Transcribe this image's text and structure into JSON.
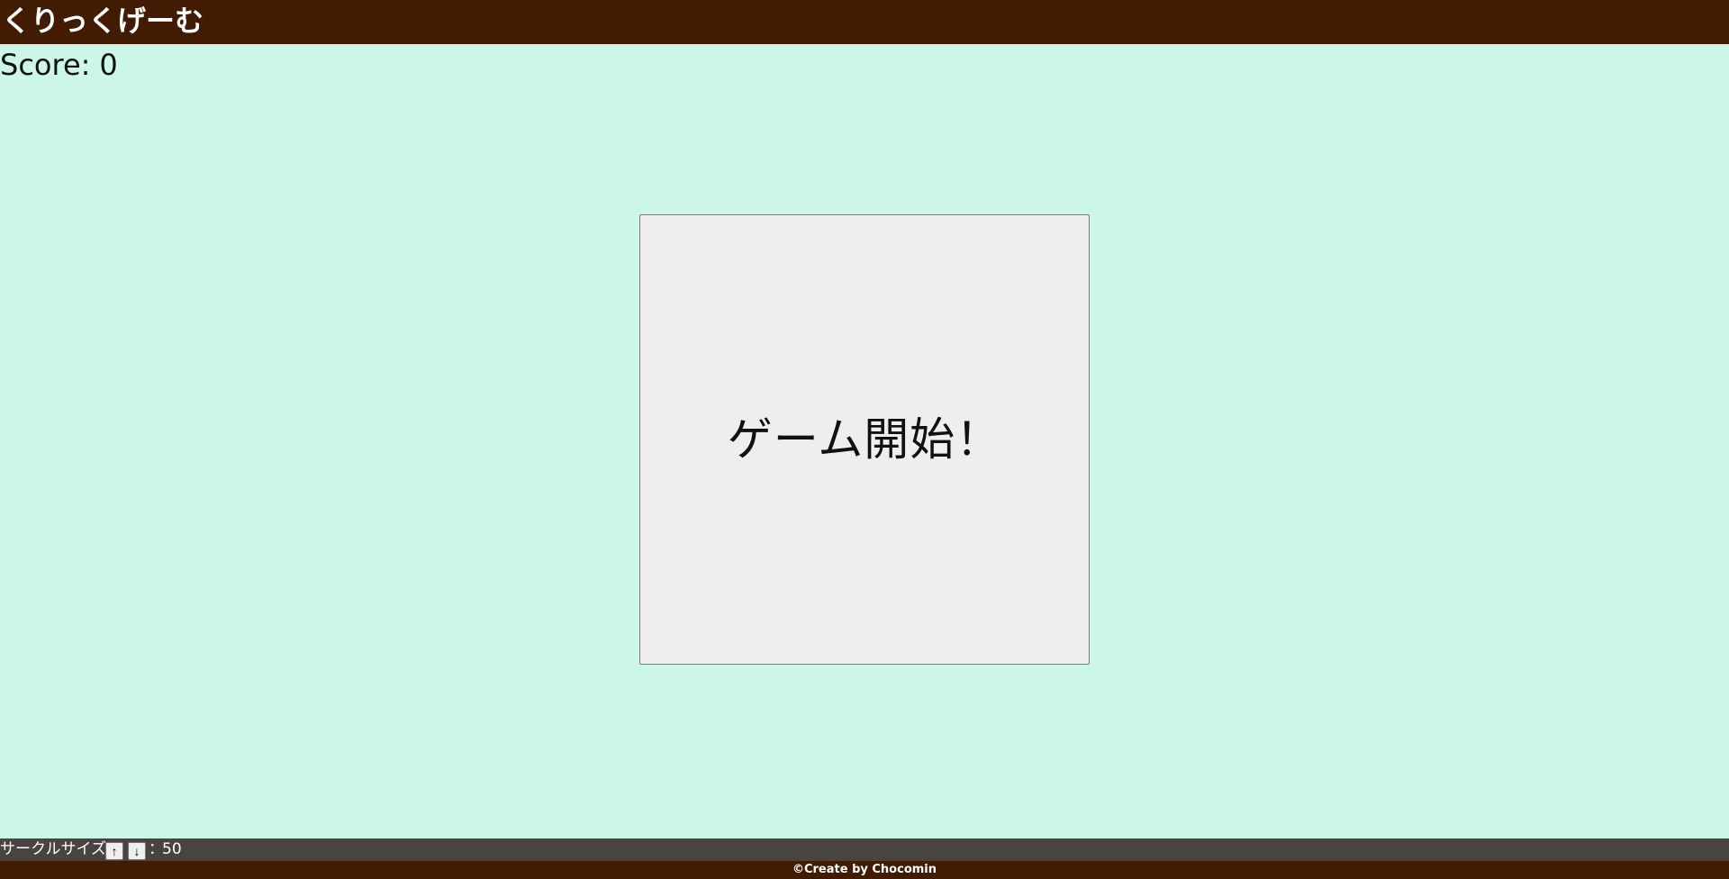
{
  "header": {
    "title": "くりっくげーむ"
  },
  "score": {
    "label": "Score:",
    "value": "0"
  },
  "game": {
    "start_label": "ゲーム開始！"
  },
  "circle_size": {
    "label": "サークルサイズ",
    "up_label": "↑",
    "down_label": "↓",
    "separator": "：",
    "value": "50"
  },
  "footer": {
    "credit": "©Create by Chocomin"
  },
  "colors": {
    "header_bg": "#421c02",
    "page_bg": "#ccf6ea",
    "start_button_bg": "#eeeeee",
    "control_bar_bg": "#4a4441"
  }
}
